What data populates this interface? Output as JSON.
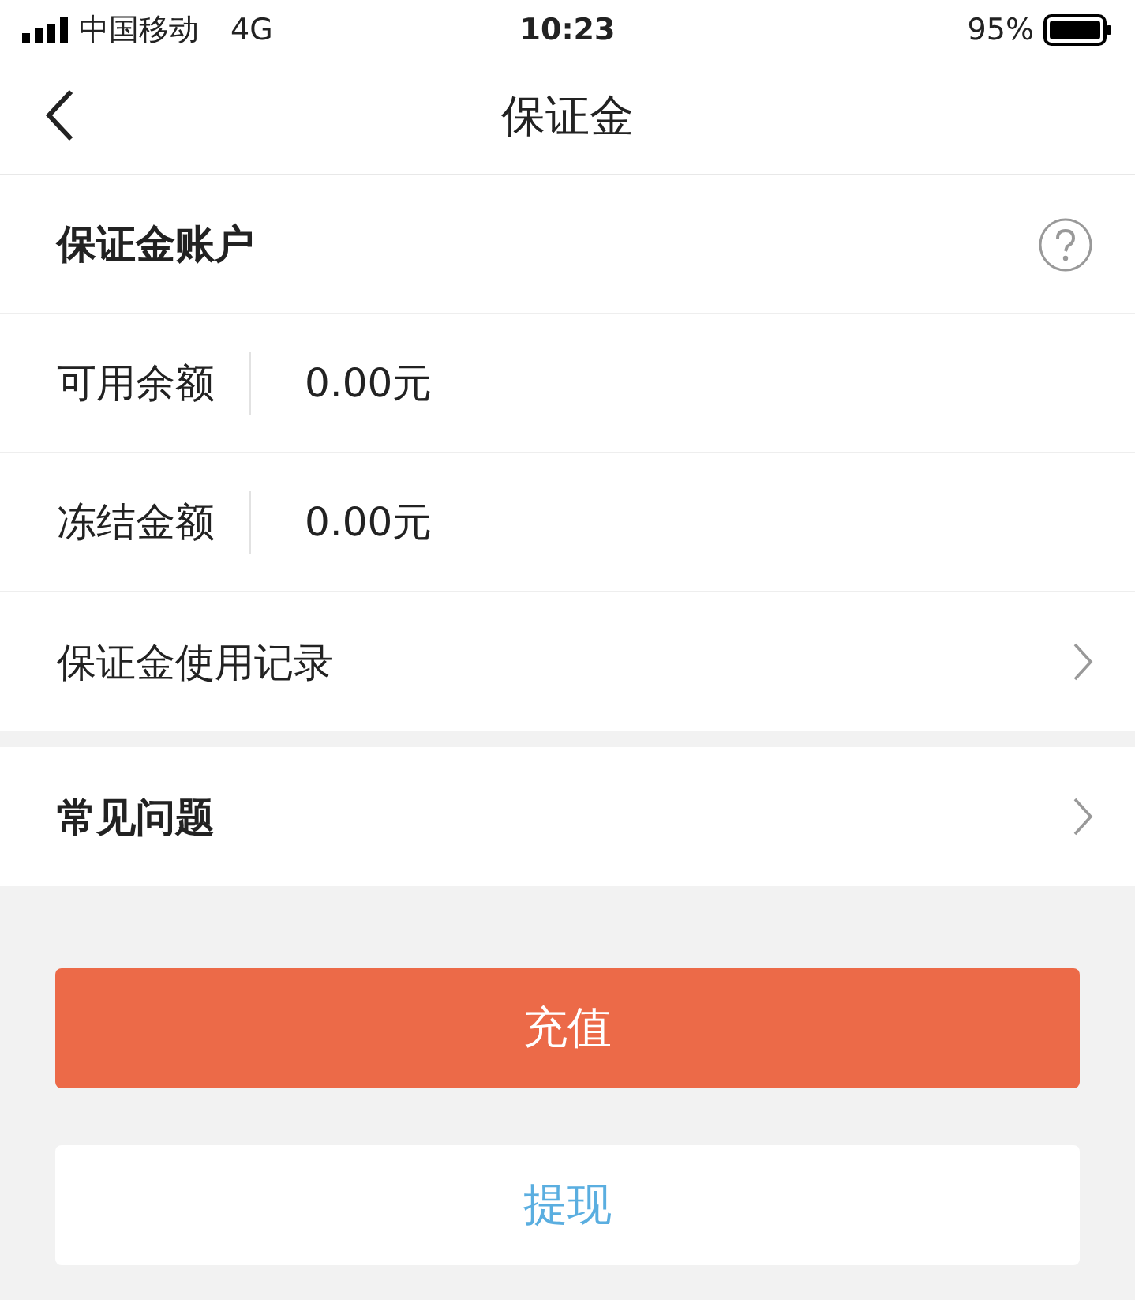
{
  "status_bar": {
    "carrier": "中国移动",
    "network": "4G",
    "time": "10:23",
    "battery": "95%"
  },
  "nav": {
    "title": "保证金"
  },
  "account": {
    "title": "保证金账户"
  },
  "balances": [
    {
      "label": "可用余额",
      "value": "0.00元"
    },
    {
      "label": "冻结金额",
      "value": "0.00元"
    }
  ],
  "account_links": [
    {
      "label": "保证金使用记录",
      "bold": false
    }
  ],
  "help_links": [
    {
      "label": "常见问题",
      "bold": true
    }
  ],
  "buttons": [
    {
      "label": "充值",
      "kind": "primary"
    },
    {
      "label": "提现",
      "kind": "secondary"
    }
  ]
}
